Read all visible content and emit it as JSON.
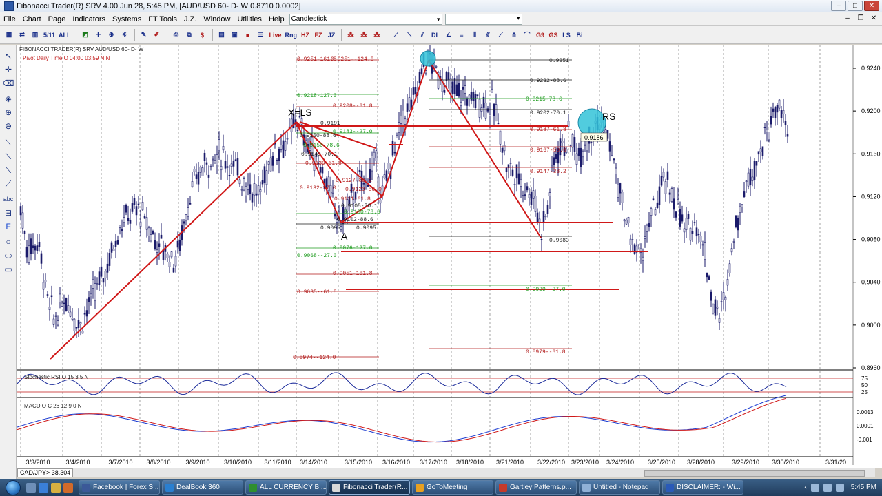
{
  "window": {
    "title": "Fibonacci Trader(R) SRV 4.00 Jun 28,  5:45 PM, [AUD/USD 60- D- W 0.8710  0.0002]"
  },
  "menu": {
    "items": [
      "File",
      "Chart",
      "Page",
      "Indicators",
      "Systems",
      "FT Tools",
      "J.Z.",
      "Window",
      "Utilities",
      "Help"
    ],
    "chart_type": "Candlestick"
  },
  "toolbar": {
    "buttons": [
      "AUD",
      "CAD",
      "ALL",
      "TIME",
      "Live Fibo",
      "Live Fibo",
      "HZ",
      "FZ",
      "JZ",
      "Label",
      "Label",
      "Label",
      "DL",
      "LS",
      "Bi"
    ],
    "labels": {
      "b1": "5/11",
      "b2": "ALL",
      "b3": "Live",
      "b4": "Rng",
      "b5": "HZ",
      "b6": "FZ",
      "b7": "JZ",
      "b8": "DL",
      "b9": "G9",
      "b10": "GS",
      "b11": "LS",
      "b12": "Bi"
    }
  },
  "chart": {
    "header_left": "FIBONACCI TRADER(R) SRV      AUD/USD 60- D- W",
    "pivot_label": "Pivot Daily Time O 04:00 03:59 N N",
    "pattern_labels": {
      "xls": "X=LS",
      "a": "A",
      "rs": "RS"
    },
    "price_axis": [
      "0.9240",
      "0.9200",
      "0.9160",
      "0.9120",
      "0.9080",
      "0.9040",
      "0.9000",
      "0.8960"
    ],
    "date_axis": [
      "3/3/2010",
      "3/4/2010",
      "3/7/2010",
      "3/8/2010",
      "3/9/2010",
      "3/10/2010",
      "3/11/2010",
      "3/14/2010",
      "3/15/2010",
      "3/16/2010",
      "3/17/2010",
      "3/18/2010",
      "3/21/2010",
      "3/22/2010",
      "3/23/2010",
      "3/24/2010",
      "3/25/2010",
      "3/28/2010",
      "3/29/2010",
      "3/30/2010",
      "3/31/20"
    ],
    "fib_levels_left": [
      {
        "text": "0.9251-161.8",
        "color": "#b01818"
      },
      {
        "text": "0.9251--124.0",
        "color": "#b01818"
      },
      {
        "text": "0.9218-127.0",
        "color": "#1b9a1b"
      },
      {
        "text": "0.9208--61.8",
        "color": "#b01818"
      },
      {
        "text": "0.9183--27.0",
        "color": "#1b9a1b"
      },
      {
        "text": "0.9191",
        "color": "#1a1a1a"
      },
      {
        "text": "0.9160-88.6",
        "color": "#1a1a1a"
      },
      {
        "text": "0.9150-78.6",
        "color": "#1b9a1b"
      },
      {
        "text": "0.9149-70.1",
        "color": "#1a1a1a"
      },
      {
        "text": "0.9139-61.8",
        "color": "#b01818"
      },
      {
        "text": "0.9132-27.0",
        "color": "#b01818"
      },
      {
        "text": "0.9127-88.2",
        "color": "#b01818"
      },
      {
        "text": "0.9120-50.0",
        "color": "#b01818"
      },
      {
        "text": "0.9111-61.8",
        "color": "#b01818"
      },
      {
        "text": "0.9105-70.1",
        "color": "#1a1a1a"
      },
      {
        "text": "0.9100-78.6",
        "color": "#1b9a1b"
      },
      {
        "text": "0.9102-88.6",
        "color": "#1a1a1a"
      },
      {
        "text": "0.9095",
        "color": "#1a1a1a"
      },
      {
        "text": "0.9095",
        "color": "#1a1a1a"
      },
      {
        "text": "0.9076-127.0",
        "color": "#1b9a1b"
      },
      {
        "text": "0.9068--27.0",
        "color": "#1b9a1b"
      },
      {
        "text": "0.9051-161.8",
        "color": "#b01818"
      },
      {
        "text": "0.9035--61.8",
        "color": "#b01818"
      },
      {
        "text": "0.8974--124.0",
        "color": "#b01818"
      }
    ],
    "fib_levels_right": [
      {
        "text": "0.9251",
        "color": "#1a1a1a"
      },
      {
        "text": "0.9232-88.6",
        "color": "#1a1a1a"
      },
      {
        "text": "0.9215-78.6",
        "color": "#1b9a1b"
      },
      {
        "text": "0.9202-70.1",
        "color": "#1a1a1a"
      },
      {
        "text": "0.9187-61.8",
        "color": "#b01818"
      },
      {
        "text": "0.9167-50.0",
        "color": "#b01818"
      },
      {
        "text": "0.9147-38.2",
        "color": "#b01818"
      },
      {
        "text": "0.9083",
        "color": "#1a1a1a"
      },
      {
        "text": "0.9029--27.0",
        "color": "#1b9a1b"
      },
      {
        "text": "0.8979--61.8",
        "color": "#b01818"
      }
    ],
    "price_tag": "0.9186",
    "stoch_label": "Stochastic RSI O 15 3 5 N",
    "stoch_axis": [
      "75",
      "50",
      "25"
    ],
    "macd_label": "MACD O C 26 12 9 0 N",
    "macd_axis": [
      "0.0013",
      "0.0001",
      "-0.001"
    ],
    "status_pair": "CAD/JPY>",
    "status_value": "38.304"
  },
  "taskbar": {
    "tasks": [
      {
        "label": "Facebook | Forex S...",
        "color": "#3b5998"
      },
      {
        "label": "DealBook 360",
        "color": "#2a7fd0"
      },
      {
        "label": "ALL CURRENCY BI...",
        "color": "#2f8f2f"
      },
      {
        "label": "Fibonacci Trader(R...",
        "color": "#d8d8d8"
      },
      {
        "label": "GoToMeeting",
        "color": "#e8a020"
      },
      {
        "label": "Gartley Patterns.p...",
        "color": "#c43a2a"
      },
      {
        "label": "Untitled - Notepad",
        "color": "#8fb0d6"
      },
      {
        "label": "DISCLAIMER: - Wi...",
        "color": "#2a5ab8"
      }
    ],
    "clock": "5:45 PM"
  }
}
